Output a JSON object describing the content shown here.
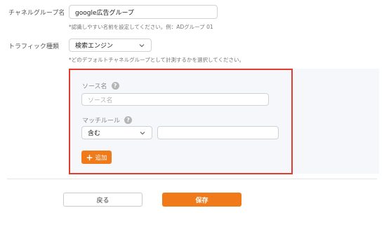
{
  "form": {
    "channel_group": {
      "label": "チャネルグループ名",
      "value": "google広告グループ",
      "hint": "*認識しやすい名前を設定してください。例：ADグループ 01"
    },
    "traffic_type": {
      "label": "トラフィック種類",
      "value": "検索エンジン",
      "hint": "*どのデフォルトチャネルグループとして計測するかを選択してください。"
    },
    "rule_panel": {
      "source_name": {
        "label": "ソース名",
        "placeholder": "ソース名",
        "help": "?"
      },
      "match_rule": {
        "label": "マッチルール",
        "help": "?",
        "condition_value": "含む",
        "value": ""
      },
      "add_label": "追加",
      "add_icon": "plus-icon"
    }
  },
  "footer": {
    "back_label": "戻る",
    "save_label": "保存"
  },
  "colors": {
    "accent": "#f07a1a",
    "highlight_border": "#e53a2e",
    "panel_bg": "#f5f7fb"
  }
}
